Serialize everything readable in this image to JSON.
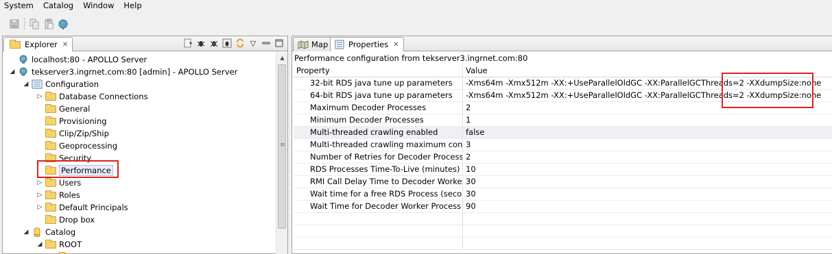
{
  "menubar": {
    "items": [
      "System",
      "Catalog",
      "Window",
      "Help"
    ]
  },
  "toolbar": {
    "buttons": [
      "save-icon",
      "copy-icon",
      "paste-icon",
      "globe-icon"
    ]
  },
  "explorer": {
    "tab_label": "Explorer",
    "tab_close": "✕",
    "tree": [
      {
        "label": "localhost:80 - APOLLO Server",
        "icon": "server-icon",
        "twisty": ""
      },
      {
        "label": "tekserver3.ingrnet.com:80 [admin] - APOLLO Server",
        "icon": "server-icon",
        "twisty": "◢"
      },
      {
        "label": "Configuration",
        "icon": "list-icon",
        "twisty": "◢"
      },
      {
        "label": "Database Connections",
        "icon": "folder-icon",
        "twisty": "▷"
      },
      {
        "label": "General",
        "icon": "folder-icon",
        "twisty": ""
      },
      {
        "label": "Provisioning",
        "icon": "folder-icon",
        "twisty": ""
      },
      {
        "label": "Clip/Zip/Ship",
        "icon": "folder-icon",
        "twisty": ""
      },
      {
        "label": "Geoprocessing",
        "icon": "folder-icon",
        "twisty": ""
      },
      {
        "label": "Security",
        "icon": "folder-icon",
        "twisty": ""
      },
      {
        "label": "Performance",
        "icon": "folder-icon",
        "twisty": "",
        "selected": true
      },
      {
        "label": "Users",
        "icon": "folder-icon",
        "twisty": "▷"
      },
      {
        "label": "Roles",
        "icon": "folder-icon",
        "twisty": "▷"
      },
      {
        "label": "Default Principals",
        "icon": "folder-icon",
        "twisty": "▷"
      },
      {
        "label": "Drop box",
        "icon": "folder-icon",
        "twisty": ""
      },
      {
        "label": "Catalog",
        "icon": "database-icon",
        "twisty": "◢"
      },
      {
        "label": "ROOT",
        "icon": "folder-icon",
        "twisty": "◢"
      }
    ]
  },
  "right": {
    "tab_map": "Map",
    "tab_properties": "Properties",
    "tab_close": "✕",
    "config_title": "Performance configuration from tekserver3.ingrnet.com:80",
    "col_property": "Property",
    "col_value": "Value",
    "rows": [
      {
        "property": "32-bit RDS java tune up parameters",
        "value": "-Xms64m -Xmx512m -XX:+UseParallelOldGC -XX:ParallelGCThreads=2 -XXdumpSize:none"
      },
      {
        "property": "64-bit RDS java tune up parameters",
        "value": "-Xms64m -Xmx512m -XX:+UseParallelOldGC -XX:ParallelGCThreads=2 -XXdumpSize:none"
      },
      {
        "property": "Maximum Decoder Processes",
        "value": "2"
      },
      {
        "property": "Minimum Decoder Processes",
        "value": "1"
      },
      {
        "property": "Multi-threaded crawling enabled",
        "value": "false"
      },
      {
        "property": "Multi-threaded crawling maximum concu",
        "value": "3"
      },
      {
        "property": "Number of Retries for Decoder Processes",
        "value": "2"
      },
      {
        "property": "RDS Processes Time-To-Live (minutes)",
        "value": "10"
      },
      {
        "property": "RMI Call Delay Time to Decoder Worker Pr",
        "value": "30"
      },
      {
        "property": "Wait time for a free RDS Process (seconds)",
        "value": "30"
      },
      {
        "property": "Wait Time for Decoder Worker Process Re",
        "value": "90"
      }
    ]
  }
}
